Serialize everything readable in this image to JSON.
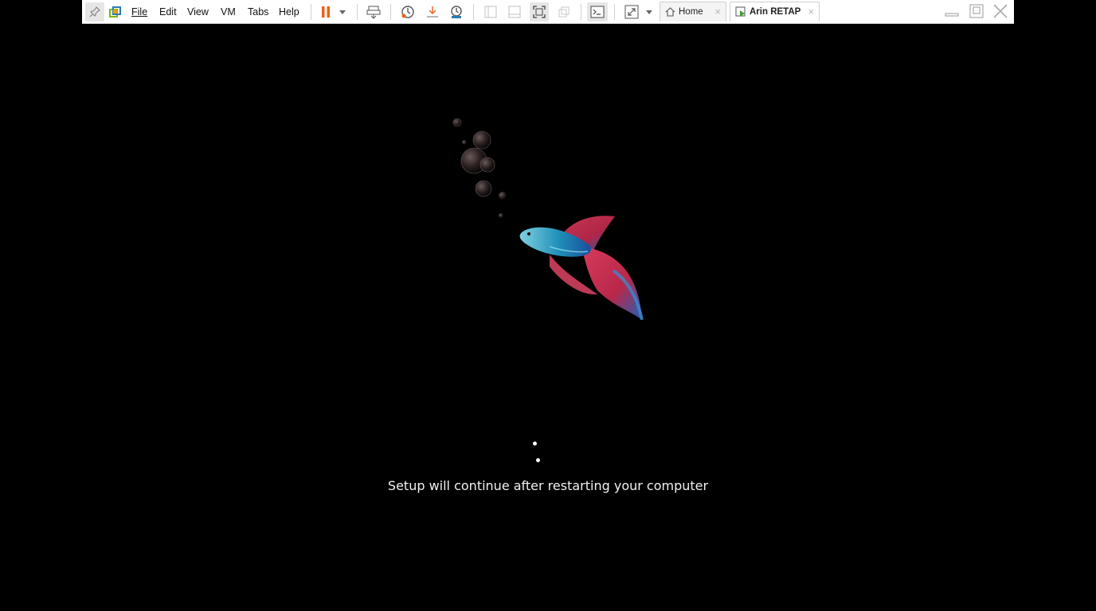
{
  "menu": {
    "file": "File",
    "edit": "Edit",
    "view": "View",
    "vm": "VM",
    "tabs": "Tabs",
    "help": "Help"
  },
  "tabs": [
    {
      "label": "Home",
      "close": "×"
    },
    {
      "label": "Arin RETAP",
      "close": "×"
    }
  ],
  "window_controls": {
    "minimize": "minimize-icon",
    "restore": "restore-icon",
    "close": "close-icon"
  },
  "icons": [
    "pin-icon",
    "vmware-logo-icon",
    "pause-icon",
    "dropdown-arrow-icon",
    "send-ctrl-alt-del-icon",
    "snapshot-icon",
    "revert-snapshot-icon",
    "snapshot-manager-icon",
    "console-view-icon",
    "thumbnail-view-icon",
    "fit-window-icon",
    "unity-icon",
    "terminal-icon",
    "fullscreen-icon",
    "home-icon",
    "vm-running-icon",
    "betta-fish-icon",
    "bubbles-icon"
  ],
  "colors": {
    "pause": "#e8641b",
    "accent": "#2a7ab8",
    "screen_bg": "#000000",
    "status_text": "#f1f1f1"
  },
  "screen": {
    "status_text": "Setup will continue after restarting your computer"
  }
}
